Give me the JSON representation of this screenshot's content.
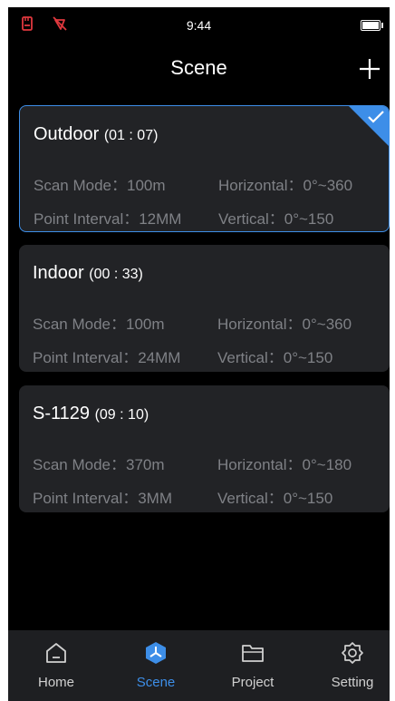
{
  "status_bar": {
    "time": "9:44"
  },
  "header": {
    "title": "Scene"
  },
  "scenes": [
    {
      "name": "Outdoor",
      "duration": "(01 : 07)",
      "scan_mode": "Scan Mode：100m",
      "horizontal": "Horizontal：0°~360",
      "point_interval": "Point Interval：12MM",
      "vertical": "Vertical：0°~150",
      "selected": true
    },
    {
      "name": "Indoor",
      "duration": "(00 : 33)",
      "scan_mode": "Scan Mode：100m",
      "horizontal": "Horizontal：0°~360",
      "point_interval": "Point Interval：24MM",
      "vertical": "Vertical：0°~150",
      "selected": false
    },
    {
      "name": "S-1129",
      "duration": "(09 : 10)",
      "scan_mode": "Scan Mode：370m",
      "horizontal": "Horizontal：0°~180",
      "point_interval": "Point Interval：3MM",
      "vertical": "Vertical：0°~150",
      "selected": false
    }
  ],
  "tabs": [
    {
      "label": "Home",
      "icon": "home-icon",
      "active": false
    },
    {
      "label": "Scene",
      "icon": "scene-icon",
      "active": true
    },
    {
      "label": "Project",
      "icon": "folder-icon",
      "active": false
    },
    {
      "label": "Setting",
      "icon": "gear-icon",
      "active": false
    }
  ],
  "colors": {
    "accent": "#3d8ee8",
    "card_bg": "#222326",
    "background": "#000000",
    "muted_text": "#7f8186",
    "status_icon": "#e0383e"
  }
}
